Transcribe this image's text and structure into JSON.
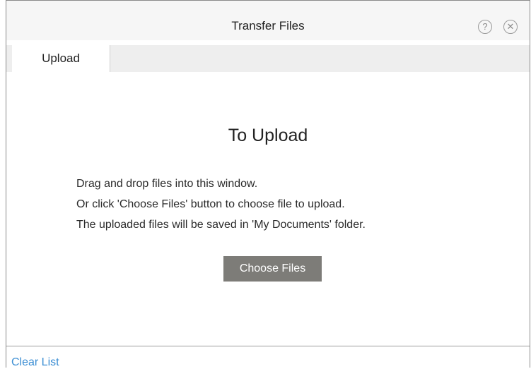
{
  "dialog": {
    "title": "Transfer Files",
    "help_icon_glyph": "?",
    "close_icon_glyph": "✕"
  },
  "tabs": [
    {
      "label": "Upload",
      "active": true
    }
  ],
  "upload_panel": {
    "heading": "To Upload",
    "lines": [
      "Drag and drop files into this window.",
      "Or click 'Choose Files' button to choose file to upload.",
      "The uploaded files will be saved in 'My Documents' folder."
    ],
    "choose_button_label": "Choose Files"
  },
  "footer": {
    "clear_list_label": "Clear List"
  },
  "colors": {
    "button_bg": "#7d7c78",
    "link": "#3d8fd4",
    "titlebar_bg": "#f6f6f6",
    "tabbar_bg": "#eeeeee"
  }
}
